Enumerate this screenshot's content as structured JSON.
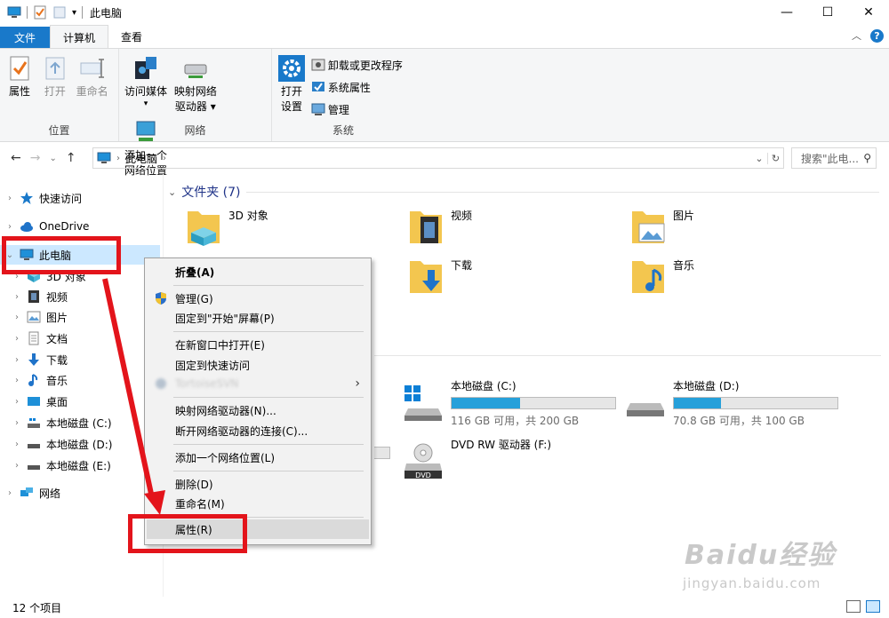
{
  "window": {
    "title": "此电脑"
  },
  "ribbon_tabs": {
    "file": "文件",
    "computer": "计算机",
    "view": "查看"
  },
  "ribbon": {
    "location": {
      "label": "位置",
      "properties": "属性",
      "open": "打开",
      "rename": "重命名"
    },
    "network": {
      "label": "网络",
      "access_media_l1": "访问媒体",
      "access_media_l2": "▾",
      "map_drive_l1": "映射网络",
      "map_drive_l2": "驱动器 ▾",
      "add_location_l1": "添加一个",
      "add_location_l2": "网络位置"
    },
    "system": {
      "label": "系统",
      "settings_l1": "打开",
      "settings_l2": "设置",
      "uninstall": "卸载或更改程序",
      "sys_props": "系统属性",
      "manage": "管理"
    }
  },
  "address": {
    "path": "此电脑",
    "search_placeholder": "搜索\"此电..."
  },
  "nav_pane": {
    "quick_access": "快速访问",
    "onedrive": "OneDrive",
    "this_pc": "此电脑",
    "objects3d": "3D 对象",
    "videos": "视频",
    "pictures": "图片",
    "documents": "文档",
    "downloads": "下载",
    "music": "音乐",
    "desktop": "桌面",
    "disk_c": "本地磁盘 (C:)",
    "disk_d": "本地磁盘 (D:)",
    "disk_e": "本地磁盘 (E:)",
    "network": "网络"
  },
  "content": {
    "folders_header": "文件夹 (7)",
    "folders": {
      "objects3d": "3D 对象",
      "videos": "视频",
      "pictures": "图片",
      "downloads": "下载",
      "music": "音乐"
    },
    "drives": [
      {
        "name": "本地磁盘 (C:)",
        "info": "116 GB 可用，共 200 GB",
        "used_fraction": 0.42
      },
      {
        "name": "本地磁盘 (D:)",
        "info": "70.8 GB 可用，共 100 GB",
        "used_fraction": 0.29
      },
      {
        "name": "DVD RW 驱动器 (F:)"
      }
    ]
  },
  "context_menu": {
    "collapse": "折叠(A)",
    "manage": "管理(G)",
    "pin_start": "固定到\"开始\"屏幕(P)",
    "open_new_window": "在新窗口中打开(E)",
    "pin_quick": "固定到快速访问",
    "blurred": "TortoiseSVN",
    "map_drive": "映射网络驱动器(N)...",
    "disconnect": "断开网络驱动器的连接(C)...",
    "add_location": "添加一个网络位置(L)",
    "delete": "删除(D)",
    "rename": "重命名(M)",
    "properties": "属性(R)"
  },
  "status": {
    "count": "12 个项目"
  },
  "watermark": {
    "main": "Baidu经验",
    "sub": "jingyan.baidu.com"
  },
  "colors": {
    "accent": "#1979ca",
    "selection": "#cce8ff",
    "annotation": "#e3141b",
    "drive_fill": "#26a0da"
  }
}
